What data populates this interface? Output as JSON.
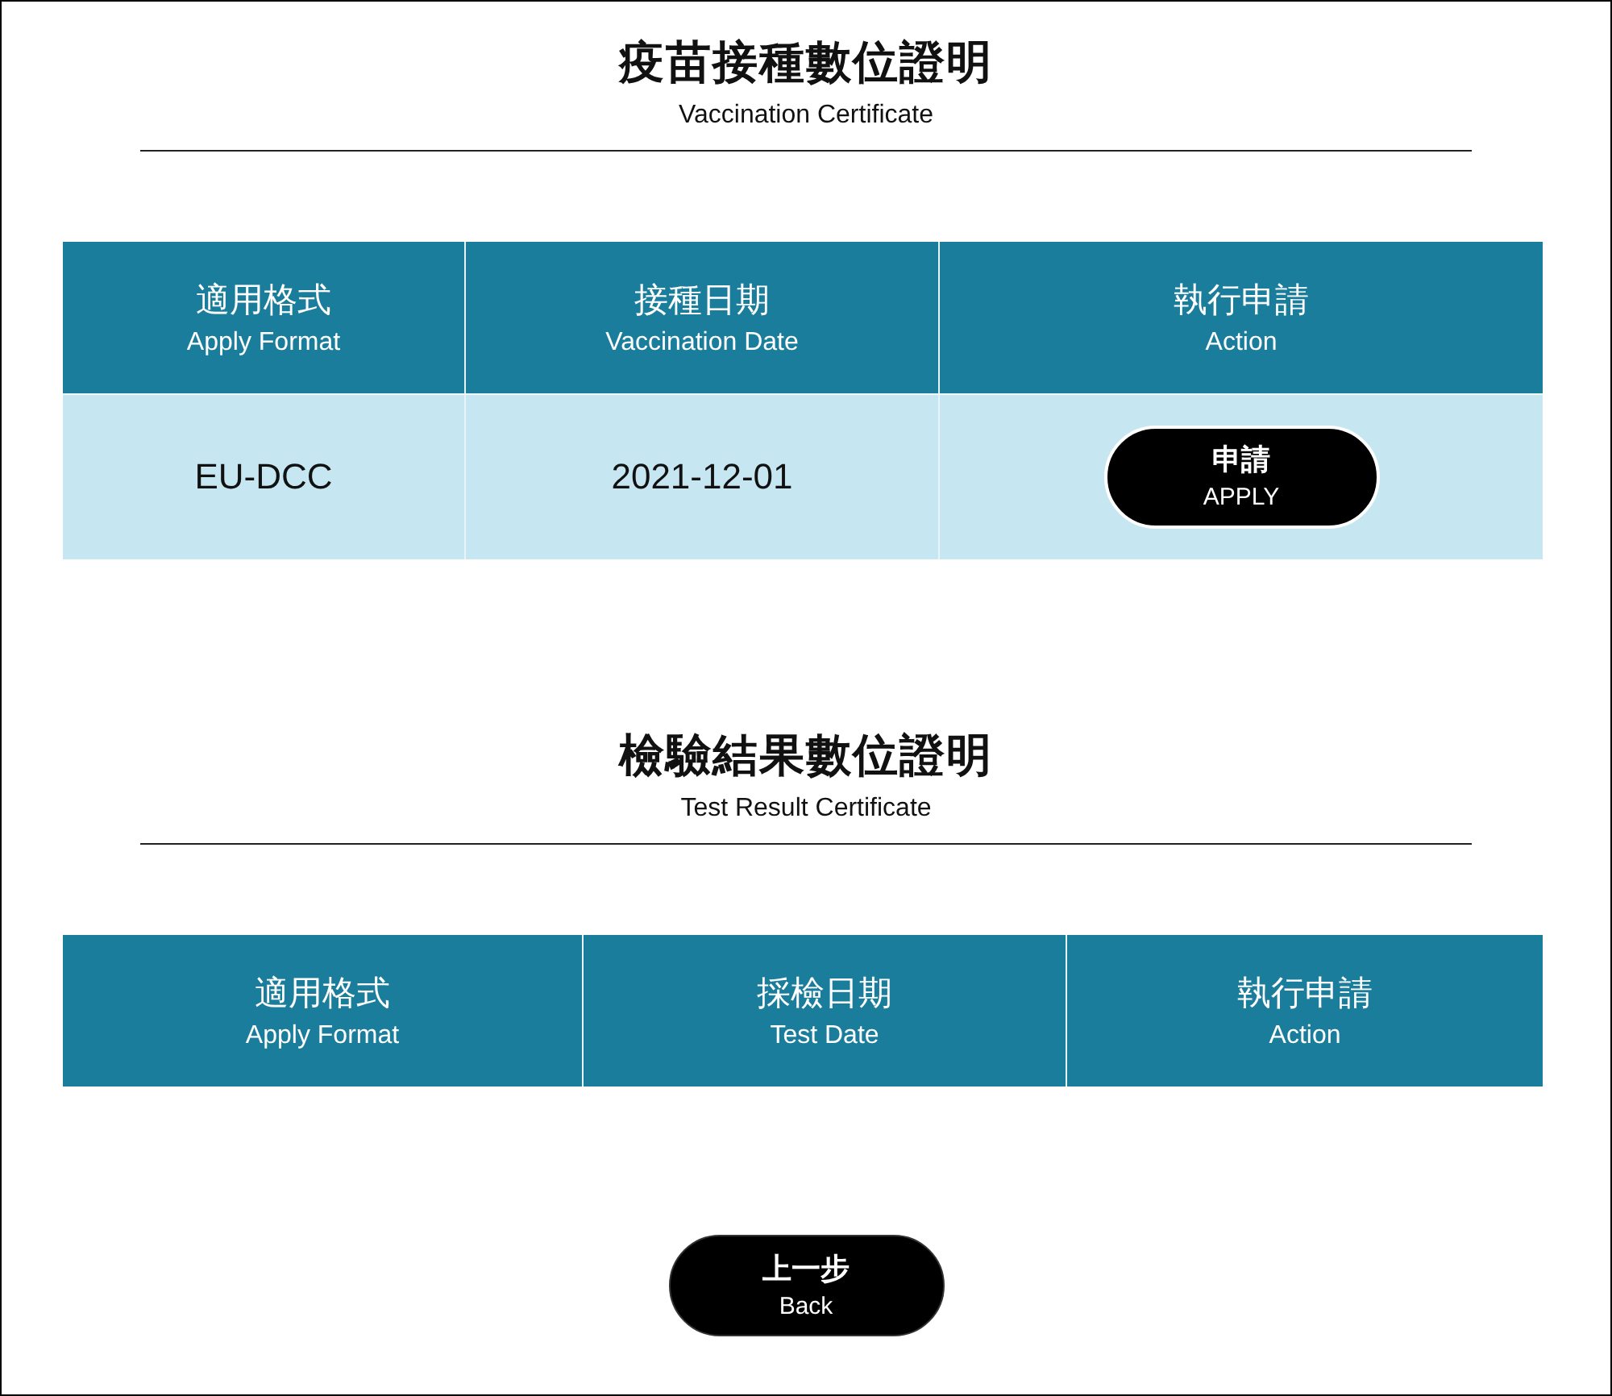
{
  "sections": [
    {
      "title": "疫苗接種數位證明",
      "subtitle": "Vaccination Certificate",
      "table": {
        "columns": [
          {
            "label": "適用格式",
            "sublabel": "Apply Format"
          },
          {
            "label": "接種日期",
            "sublabel": "Vaccination Date"
          },
          {
            "label": "執行申請",
            "sublabel": "Action"
          }
        ],
        "rows": [
          {
            "cells": [
              {
                "kind": "text",
                "text": "EU-DCC"
              },
              {
                "kind": "text",
                "text": "2021-12-01"
              },
              {
                "kind": "button",
                "label": "申請",
                "sublabel": "APPLY"
              }
            ]
          }
        ]
      }
    },
    {
      "title": "檢驗結果數位證明",
      "subtitle": "Test Result Certificate",
      "table": {
        "columns": [
          {
            "label": "適用格式",
            "sublabel": "Apply Format"
          },
          {
            "label": "採檢日期",
            "sublabel": "Test Date"
          },
          {
            "label": "執行申請",
            "sublabel": "Action"
          }
        ]
      }
    }
  ],
  "back_button": {
    "label": "上一步",
    "sublabel": "Back"
  }
}
